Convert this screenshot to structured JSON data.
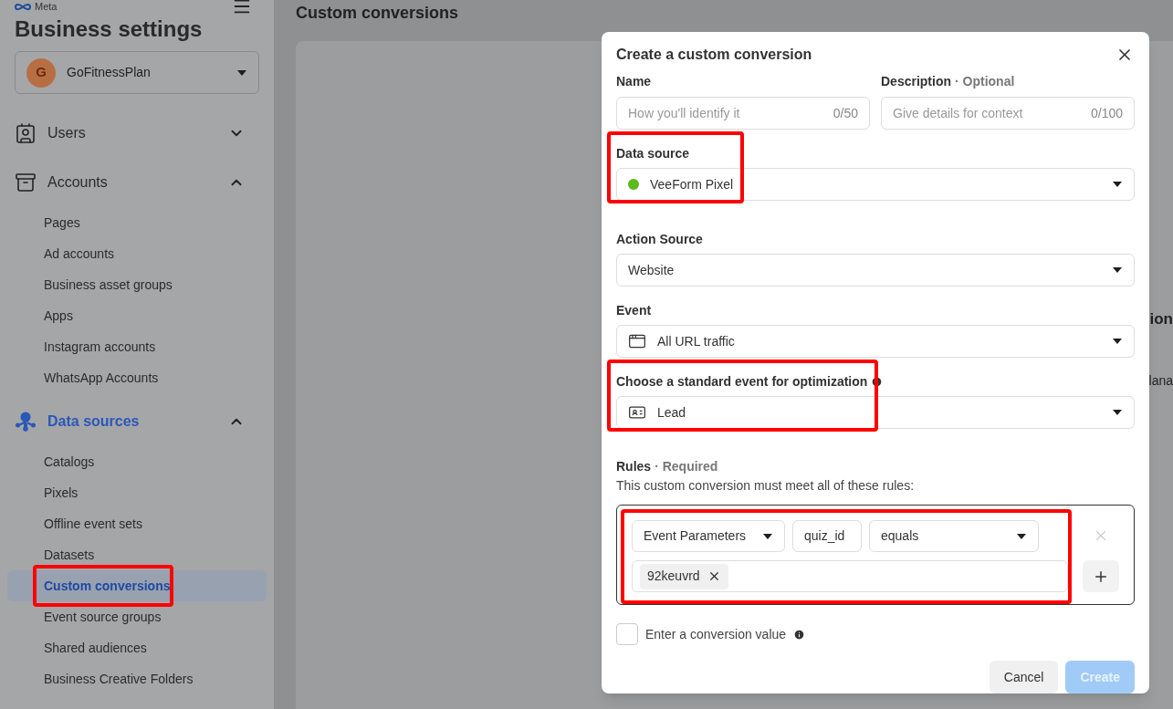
{
  "sidebar": {
    "logo_text": "Meta",
    "title": "Business settings",
    "account": {
      "initial": "G",
      "name": "GoFitnessPlan"
    },
    "sections": [
      {
        "label": "Users",
        "expanded": false,
        "selected": false
      },
      {
        "label": "Accounts",
        "expanded": true,
        "selected": false,
        "children": [
          {
            "label": "Pages",
            "selected": false,
            "highlighted": false
          },
          {
            "label": "Ad accounts",
            "selected": false,
            "highlighted": false
          },
          {
            "label": "Business asset groups",
            "selected": false,
            "highlighted": false
          },
          {
            "label": "Apps",
            "selected": false,
            "highlighted": false
          },
          {
            "label": "Instagram accounts",
            "selected": false,
            "highlighted": false
          },
          {
            "label": "WhatsApp Accounts",
            "selected": false,
            "highlighted": false
          }
        ]
      },
      {
        "label": "Data sources",
        "expanded": true,
        "selected": true,
        "children": [
          {
            "label": "Catalogs",
            "selected": false,
            "highlighted": false
          },
          {
            "label": "Pixels",
            "selected": false,
            "highlighted": false
          },
          {
            "label": "Offline event sets",
            "selected": false,
            "highlighted": false
          },
          {
            "label": "Datasets",
            "selected": false,
            "highlighted": false
          },
          {
            "label": "Custom conversions",
            "selected": true,
            "highlighted": true
          },
          {
            "label": "Event source groups",
            "selected": false,
            "highlighted": false
          },
          {
            "label": "Shared audiences",
            "selected": false,
            "highlighted": false
          },
          {
            "label": "Business Creative Folders",
            "selected": false,
            "highlighted": false
          }
        ]
      }
    ]
  },
  "page": {
    "title": "Custom conversions",
    "peek_texts": [
      "ion",
      "lana"
    ]
  },
  "dialog": {
    "title": "Create a custom conversion",
    "name_field": {
      "label": "Name",
      "placeholder": "How you'll identify it",
      "counter": "0/50"
    },
    "description_field": {
      "label": "Description",
      "note": "· Optional",
      "placeholder": "Give details for context",
      "counter": "0/100"
    },
    "selects": [
      {
        "label": "Data source",
        "value": "VeeForm Pixel",
        "color": "#5cb91e",
        "info": false,
        "highlighted": true
      },
      {
        "label": "Action Source",
        "value": "Website",
        "info": false,
        "highlighted": false
      },
      {
        "label": "Event",
        "value": "All URL traffic",
        "info": false,
        "highlighted": false
      },
      {
        "label": "Choose a standard event for optimization",
        "value": "Lead",
        "info": true,
        "highlighted": true
      }
    ],
    "rules": {
      "label": "Rules",
      "note": "· Required",
      "description": "This custom conversion must meet all of these rules:",
      "parameter": "Event Parameters",
      "key": "quiz_id",
      "operator": "equals",
      "values": [
        "92keuvrd"
      ],
      "highlighted": true
    },
    "conversion_value": {
      "label": "Enter a conversion value",
      "checked": false
    },
    "buttons": [
      {
        "label": "Cancel",
        "kind": "secondary"
      },
      {
        "label": "Create",
        "kind": "primary",
        "disabled": true
      }
    ]
  }
}
